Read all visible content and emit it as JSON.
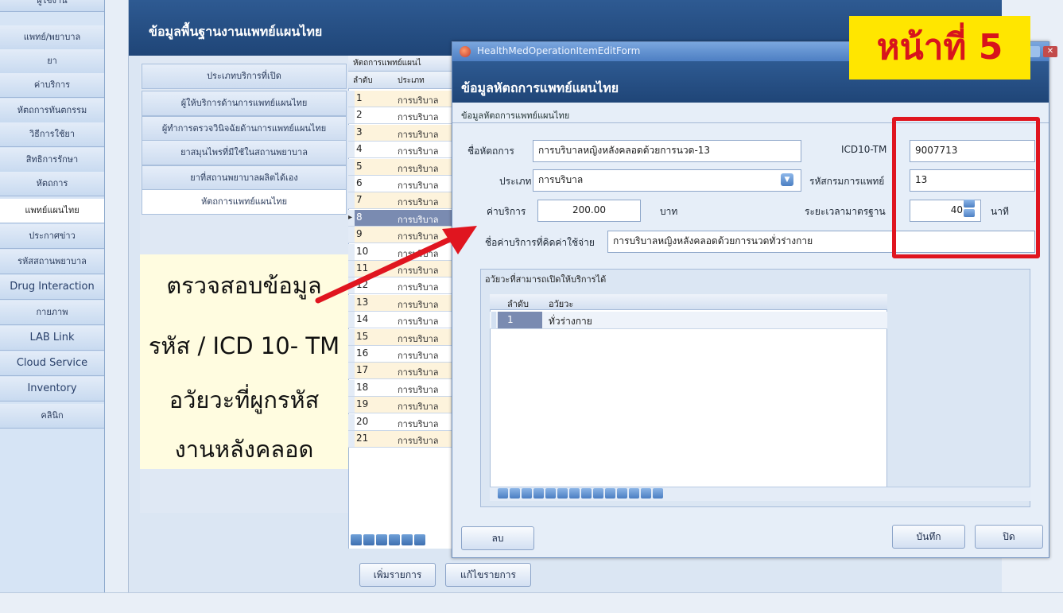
{
  "sidebar": {
    "items": [
      {
        "label": "ผู้ใช้งาน"
      },
      {
        "label": "แพทย์/พยาบาล"
      },
      {
        "label": "ยา"
      },
      {
        "label": "ค่าบริการ"
      },
      {
        "label": "หัตถการทันตกรรม"
      },
      {
        "label": "วิธีการใช้ยา"
      },
      {
        "label": "สิทธิการรักษา"
      },
      {
        "label": "หัตถการ"
      },
      {
        "label": "แพทย์แผนไทย"
      },
      {
        "label": "ประกาศข่าว"
      },
      {
        "label": "รหัสสถานพยาบาล"
      },
      {
        "label": "Drug Interaction"
      },
      {
        "label": "กายภาพ"
      },
      {
        "label": "LAB Link"
      },
      {
        "label": "Cloud Service"
      },
      {
        "label": "Inventory"
      },
      {
        "label": "คลินิก"
      }
    ]
  },
  "main": {
    "title": "ข้อมูลพื้นฐานงานแพทย์แผนไทย",
    "categories": [
      "ประเภทบริการที่เปิด",
      "ผู้ให้บริการด้านการแพทย์แผนไทย",
      "ผู้ทำการตรวจวินิจฉัยด้านการแพทย์แผนไทย",
      "ยาสมุนไพรที่มีใช้ในสถานพยาบาล",
      "ยาที่สถานพยาบาลผลิตได้เอง",
      "หัตถการแพทย์แผนไทย"
    ],
    "grid_header": "หัตถการแพทย์แผนไ",
    "grid_col_order": "ลำดับ",
    "grid_col_type": "ประเภท",
    "row_type": "การบริบาล",
    "rows": [
      "1",
      "2",
      "3",
      "4",
      "5",
      "6",
      "7",
      "8",
      "9",
      "10",
      "11",
      "12",
      "13",
      "14",
      "15",
      "16",
      "17",
      "18",
      "19",
      "20",
      "21"
    ],
    "add_button": "เพิ่มรายการ",
    "edit_button": "แก้ไขรายการ"
  },
  "annotation": {
    "lines": [
      "ตรวจสอบข้อมูล",
      "รหัส / ICD 10- TM",
      "อวัยวะที่ผูกรหัส",
      "งานหลังคลอด"
    ],
    "page_badge": "หน้าที่ 5"
  },
  "dialog": {
    "window_title": "HealthMedOperationItemEditForm",
    "header": "ข้อมูลหัตถการแพทย์แผนไทย",
    "group_label": "ข้อมูลหัตถการแพทย์แผนไทย",
    "name_label": "ชื่อหัตถการ",
    "name_value": "การบริบาลหญิงหลังคลอดด้วยการนวด-13",
    "icd_label": "ICD10-TM",
    "icd_value": "9007713",
    "type_label": "ประเภท",
    "type_value": "การบริบาล",
    "dept_code_label": "รหัสกรมการแพทย์",
    "dept_code_value": "13",
    "fee_label": "ค่าบริการ",
    "fee_value": "200.00",
    "fee_unit": "บาท",
    "duration_label": "ระยะเวลามาตรฐาน",
    "duration_value": "40",
    "duration_unit": "นาที",
    "billing_name_label": "ชื่อค่าบริการที่คิดค่าใช้จ่าย",
    "billing_name_value": "การบริบาลหญิงหลังคลอดด้วยการนวดทั่วร่างกาย",
    "organ_panel_title": "อวัยวะที่สามารถเปิดให้บริการได้",
    "organ_col_order": "ลำดับ",
    "organ_col_name": "อวัยวะ",
    "organ_rows": [
      {
        "order": "1",
        "name": "ทั่วร่างกาย"
      }
    ],
    "delete_button": "ลบ",
    "save_button": "บันทึก",
    "close_button": "ปิด"
  },
  "colors": {
    "header_blue": "#1f4577",
    "highlight_red": "#e0151f",
    "badge_yellow": "#ffe600",
    "annotation_bg": "#fffce0"
  }
}
